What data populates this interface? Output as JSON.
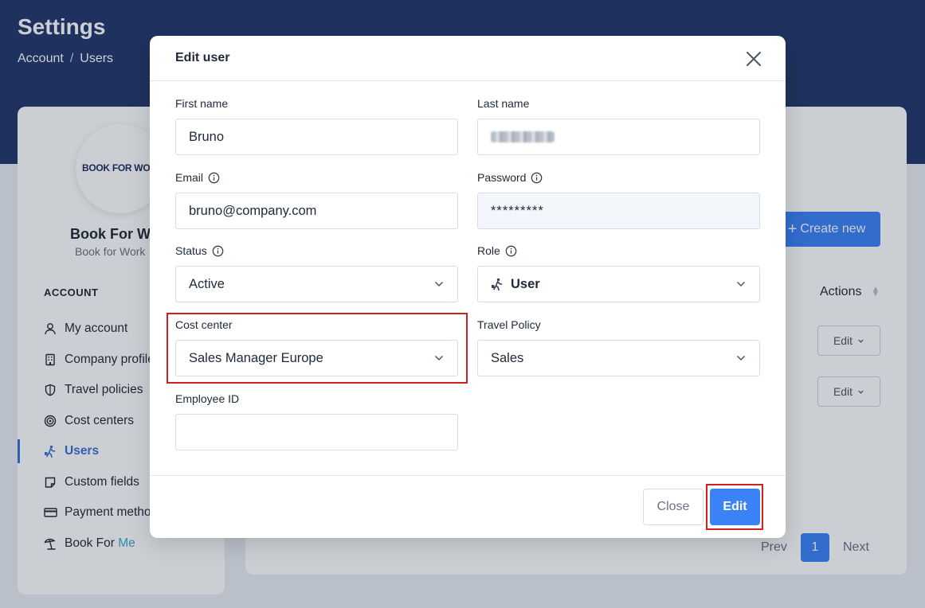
{
  "page": {
    "title": "Settings"
  },
  "breadcrumb": {
    "items": [
      "Account",
      "Users"
    ],
    "separator": "/"
  },
  "sidebar": {
    "logo_text": "BOOK FOR WORK",
    "company_name": "Book For Work",
    "company_sub": "Book for Work",
    "section": "ACCOUNT",
    "items": [
      {
        "label": "My account",
        "icon": "user-icon"
      },
      {
        "label": "Company profile",
        "icon": "building-icon"
      },
      {
        "label": "Travel policies",
        "icon": "shield-icon"
      },
      {
        "label": "Cost centers",
        "icon": "target-icon"
      },
      {
        "label": "Users",
        "icon": "traveler-icon",
        "active": true
      },
      {
        "label": "Custom fields",
        "icon": "note-icon"
      },
      {
        "label": "Payment methods",
        "icon": "card-icon"
      },
      {
        "label": "Book For",
        "accent": "Me",
        "icon": "beach-umbrella-icon"
      }
    ]
  },
  "main": {
    "create_button": "Create new",
    "actions_header": "Actions",
    "row_edit_label": "Edit",
    "pagination": {
      "prev": "Prev",
      "current": "1",
      "next": "Next"
    }
  },
  "modal": {
    "title": "Edit user",
    "fields": {
      "first_name": {
        "label": "First name",
        "value": "Bruno"
      },
      "last_name": {
        "label": "Last name",
        "value": ""
      },
      "email": {
        "label": "Email",
        "value": "bruno@company.com"
      },
      "password": {
        "label": "Password",
        "value": "*********"
      },
      "status": {
        "label": "Status",
        "value": "Active"
      },
      "role": {
        "label": "Role",
        "value": "User"
      },
      "cost_center": {
        "label": "Cost center",
        "value": "Sales Manager Europe"
      },
      "travel_policy": {
        "label": "Travel Policy",
        "value": "Sales"
      },
      "employee_id": {
        "label": "Employee ID",
        "value": ""
      }
    },
    "close_button": "Close",
    "edit_button": "Edit"
  },
  "colors": {
    "header_bg": "#23366a",
    "primary": "#3b82f6",
    "active_nav": "#3b6fd8",
    "highlight": "#d21f1f"
  }
}
